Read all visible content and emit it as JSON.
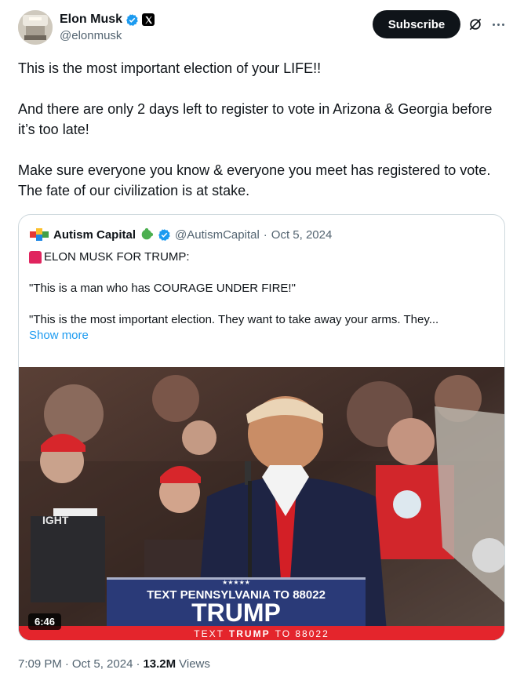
{
  "author": {
    "name": "Elon Musk",
    "handle": "@elonmusk",
    "verified_icon": "blue-check-icon",
    "affiliate_icon": "x-logo-icon"
  },
  "actions": {
    "subscribe_label": "Subscribe",
    "grok_icon": "grok-icon",
    "more_icon": "more-dots-icon"
  },
  "tweet": {
    "paragraphs": [
      "This is the most important election of your LIFE!!",
      "And there are only 2 days left to register to vote in Arizona & Georgia before it’s too late!",
      "Make sure everyone you know & everyone you meet has registered to vote. The fate of our civilization is at stake."
    ]
  },
  "quote": {
    "name": "Autism Capital",
    "handle": "@AutismCapital",
    "separator": "·",
    "date": "Oct 5, 2024",
    "line1": "ELON MUSK FOR TRUMP:",
    "line2": "\"This is a man who has COURAGE UNDER FIRE!\"",
    "line3": "\"This is the most important election. They want to take away your arms. They...",
    "show_more": "Show more",
    "video": {
      "duration": "6:46",
      "sign_top": "TEXT PENNSYLVANIA TO 88022",
      "sign_main": "TRUMP",
      "banner_left": "TEXT",
      "banner_mid": "TRUMP",
      "banner_right": "TO 88022",
      "shirt_text": "IGHT",
      "colors": {
        "banner_red": "#e4252c",
        "sign_navy": "#2a3a78"
      }
    }
  },
  "footer": {
    "time": "7:09 PM",
    "dot1": "·",
    "date": "Oct 5, 2024",
    "dot2": "·",
    "views_count": "13.2M",
    "views_label": "Views"
  },
  "colors": {
    "accent": "#1d9bf0",
    "text": "#0f1419",
    "muted": "#536471",
    "border": "#cfd9de"
  }
}
